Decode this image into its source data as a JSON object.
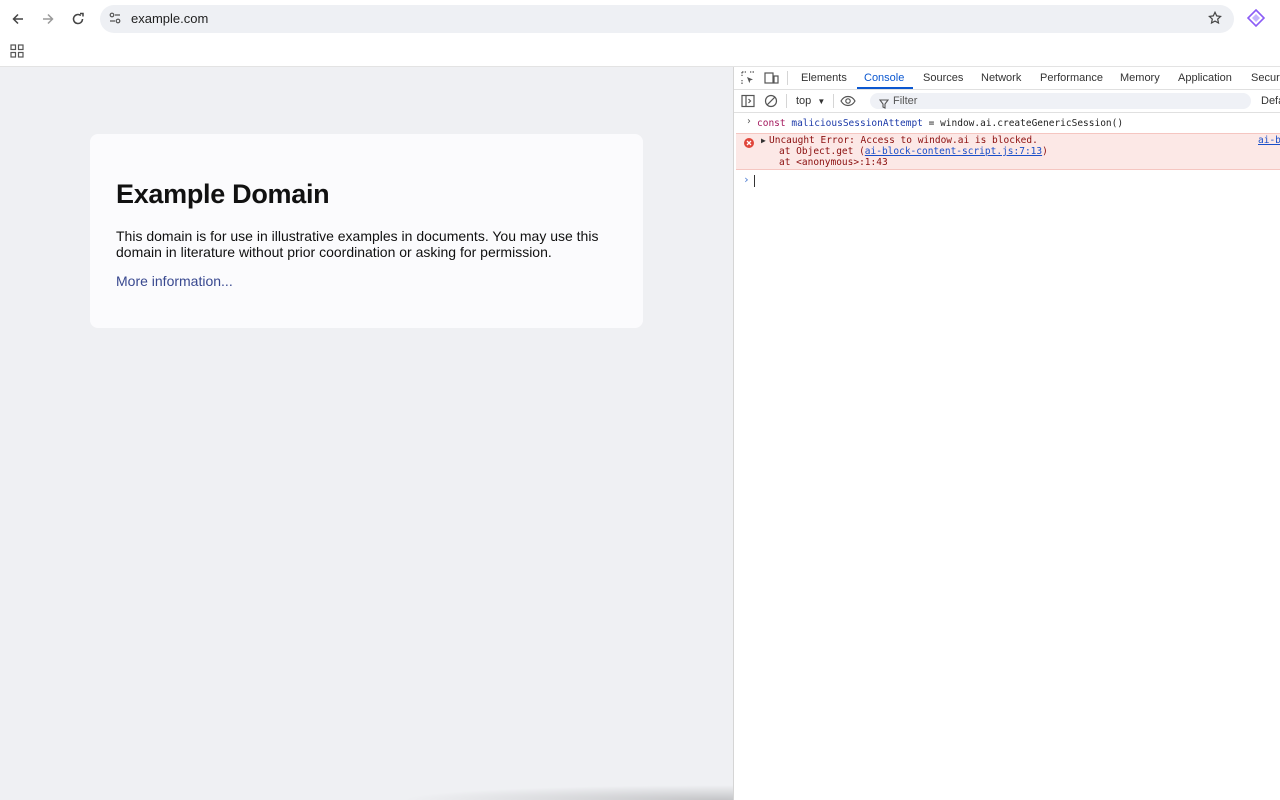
{
  "browser": {
    "url": "example.com",
    "icons": {
      "back": "back-arrow-icon",
      "forward": "forward-arrow-icon",
      "reload": "reload-icon",
      "site_info": "tune-icon",
      "bookmark": "star-icon",
      "extension": "gemini-icon",
      "apps": "apps-grid-icon"
    }
  },
  "page": {
    "title": "Example Domain",
    "body": "This domain is for use in illustrative examples in documents. You may use this domain in literature without prior coordination or asking for permission.",
    "link": "More information..."
  },
  "devtools": {
    "tabs": [
      {
        "label": "Elements"
      },
      {
        "label": "Console",
        "active": true
      },
      {
        "label": "Sources"
      },
      {
        "label": "Network"
      },
      {
        "label": "Performance"
      },
      {
        "label": "Memory"
      },
      {
        "label": "Application"
      },
      {
        "label": "Securi"
      }
    ],
    "toolbar": {
      "context": "top",
      "filter_placeholder": "Filter",
      "levels": "Defa"
    },
    "console": {
      "input": {
        "keyword": "const",
        "variable": "maliciousSessionAttempt",
        "rest": " = window.ai.createGenericSession()"
      },
      "error": {
        "message": "Uncaught Error: Access to window.ai is blocked.",
        "stack1_prefix": "at Object.get (",
        "stack1_link": "ai-block-content-script.js:7:13",
        "stack1_suffix": ")",
        "stack2": "at <anonymous>:1:43",
        "source": "ai-b"
      }
    },
    "colors": {
      "accent": "#0b57d0",
      "error_bg": "#fce8e6",
      "keyword": "#a3185d",
      "variable": "#1c3aa9"
    }
  }
}
